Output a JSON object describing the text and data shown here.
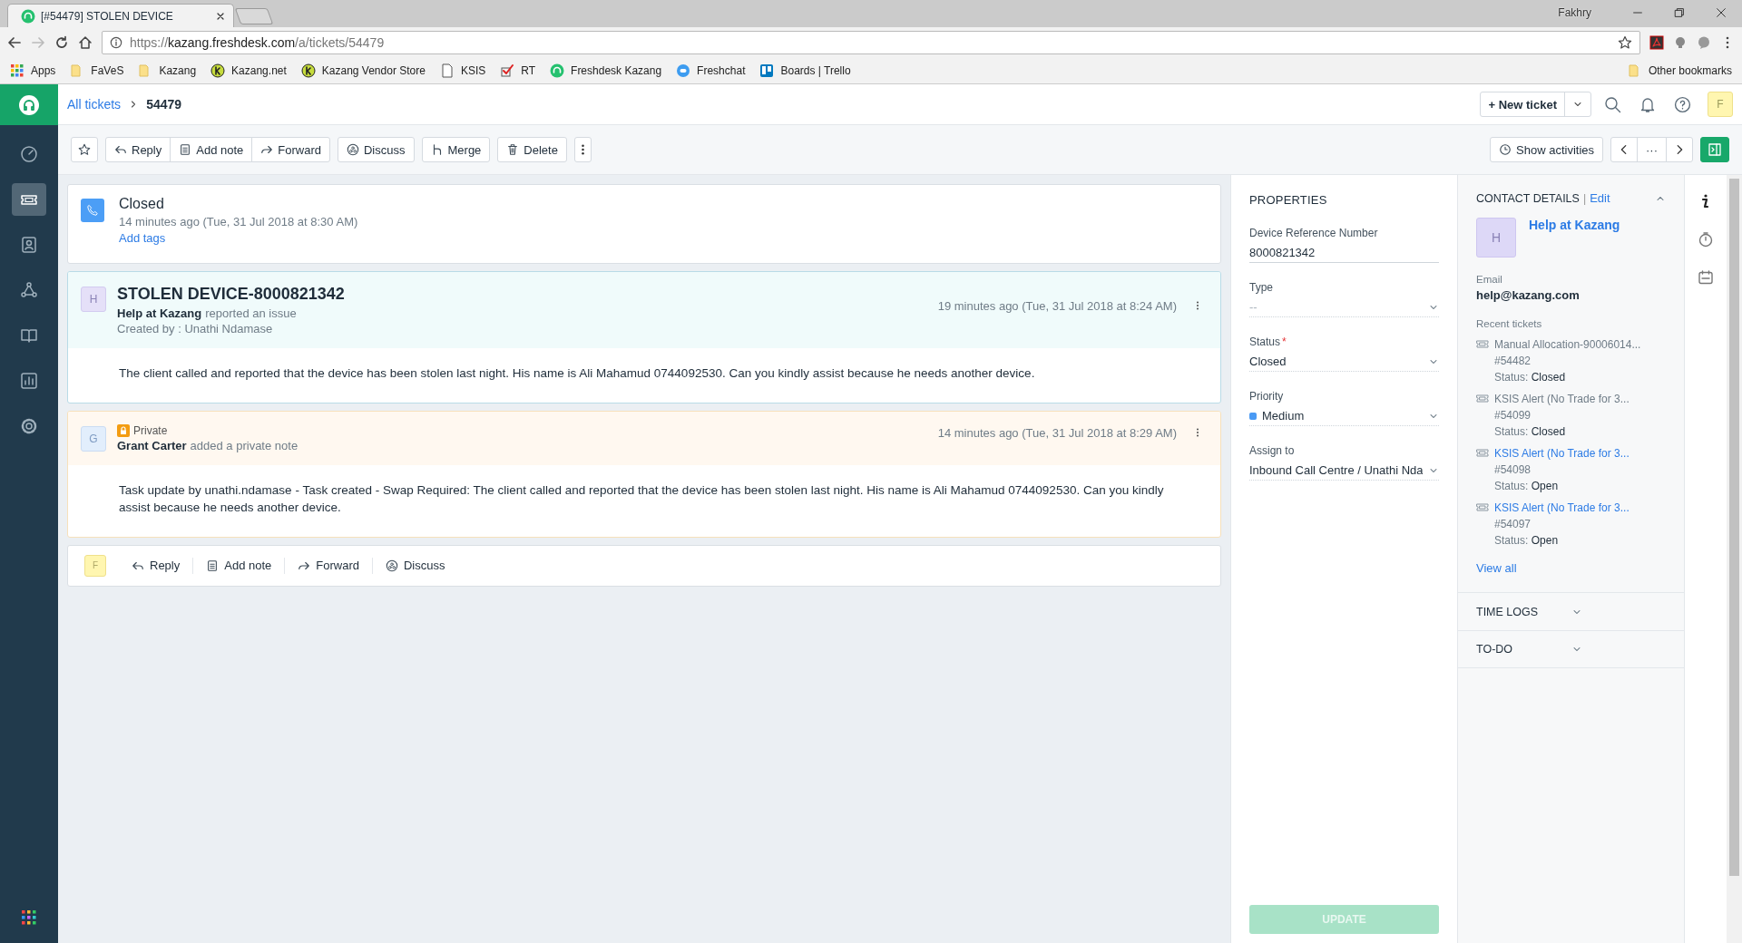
{
  "browser": {
    "tab_title": "[#54479] STOLEN DEVICE",
    "profile": "Fakhry",
    "url_scheme": "https://",
    "url_host": "kazang.freshdesk.com",
    "url_path": "/a/tickets/54479",
    "bookmarks": [
      {
        "label": "Apps",
        "kind": "apps"
      },
      {
        "label": "FaVeS",
        "kind": "folder"
      },
      {
        "label": "Kazang",
        "kind": "folder"
      },
      {
        "label": "Kazang.net",
        "kind": "k"
      },
      {
        "label": "Kazang Vendor Store",
        "kind": "k"
      },
      {
        "label": "KSIS",
        "kind": "page"
      },
      {
        "label": "RT",
        "kind": "check"
      },
      {
        "label": "Freshdesk Kazang",
        "kind": "headset"
      },
      {
        "label": "Freshchat",
        "kind": "chat"
      },
      {
        "label": "Boards | Trello",
        "kind": "board"
      }
    ],
    "other_bookmarks": "Other bookmarks"
  },
  "sidebar": {
    "items": [
      {
        "kind": "dashboard",
        "selected": false
      },
      {
        "kind": "tickets",
        "selected": true
      },
      {
        "kind": "contacts",
        "selected": false
      },
      {
        "kind": "social",
        "selected": false
      },
      {
        "kind": "solutions",
        "selected": false
      },
      {
        "kind": "reports",
        "selected": false
      },
      {
        "kind": "admin",
        "selected": false
      }
    ]
  },
  "header": {
    "breadcrumb": "All tickets",
    "ticket_id": "54479",
    "new_ticket": "New ticket",
    "new_ticket_plus": "+",
    "avatar": "F"
  },
  "toolbar": {
    "actions": [
      {
        "label": "Reply",
        "kind": "reply",
        "grouped": true
      },
      {
        "label": "Add note",
        "kind": "note",
        "grouped": true
      },
      {
        "label": "Forward",
        "kind": "forward",
        "grouped": true
      },
      {
        "label": "Discuss",
        "kind": "discuss",
        "grouped": false
      },
      {
        "label": "Merge",
        "kind": "merge",
        "grouped": false
      },
      {
        "label": "Delete",
        "kind": "delete",
        "grouped": false
      }
    ],
    "show_activities": "Show activities",
    "pager_middle": "···"
  },
  "status_card": {
    "status": "Closed",
    "time": "14 minutes ago (Tue, 31 Jul 2018 at 8:30 AM)",
    "add_tags": "Add tags"
  },
  "conversations": [
    {
      "kind": "issue",
      "avatar": "H",
      "title": "STOLEN DEVICE-8000821342",
      "author": "Help at Kazang",
      "action": "reported an issue",
      "created_by": "Created by : Unathi Ndamase",
      "time": "19 minutes ago (Tue, 31 Jul 2018 at 8:24 AM)",
      "body": "The client called and reported that the device has been stolen last night. His name is Ali Mahamud 0744092530. Can you kindly assist because he needs another device."
    },
    {
      "kind": "note",
      "avatar": "G",
      "badge": "Private",
      "author": "Grant Carter",
      "action": "added a private note",
      "time": "14 minutes ago (Tue, 31 Jul 2018 at 8:29 AM)",
      "body": "Task update by unathi.ndamase - Task created - Swap Required: The client called and reported that the device has been stolen last night. His name is Ali Mahamud 0744092530. Can you kindly assist because he needs another device."
    }
  ],
  "reply_bar": {
    "avatar": "F",
    "actions": [
      {
        "label": "Reply",
        "kind": "reply"
      },
      {
        "label": "Add note",
        "kind": "note"
      },
      {
        "label": "Forward",
        "kind": "forward"
      },
      {
        "label": "Discuss",
        "kind": "discuss"
      }
    ]
  },
  "properties": {
    "title": "PROPERTIES",
    "fields": [
      {
        "label": "Device Reference Number",
        "kind": "text",
        "required": false,
        "value": "8000821342"
      },
      {
        "label": "Type",
        "kind": "select",
        "required": false,
        "placeholder": "--"
      },
      {
        "label": "Status",
        "kind": "select",
        "required": true,
        "value": "Closed"
      },
      {
        "label": "Priority",
        "kind": "select",
        "required": false,
        "value": "Medium",
        "color": "#4a9af4"
      },
      {
        "label": "Assign to",
        "kind": "select",
        "required": false,
        "value": "Inbound Call Centre / Unathi Nda"
      }
    ],
    "required_mark": "*",
    "update": {
      "label": "UPDATE",
      "disabled": true
    }
  },
  "contact": {
    "title": "CONTACT DETAILS",
    "separator": "|",
    "edit": "Edit",
    "expanded": true,
    "avatar": "H",
    "name": "Help at Kazang",
    "email_label": "Email",
    "email": "help@kazang.com",
    "recent_label": "Recent tickets",
    "recent": [
      {
        "title": "Manual Allocation-90006014...",
        "number": "#54482",
        "status_label": "Status:",
        "status": "Closed",
        "highlighted": false
      },
      {
        "title": "KSIS Alert (No Trade for 3...",
        "number": "#54099",
        "status_label": "Status:",
        "status": "Closed",
        "highlighted": false
      },
      {
        "title": "KSIS Alert (No Trade for 3...",
        "number": "#54098",
        "status_label": "Status:",
        "status": "Open",
        "highlighted": true
      },
      {
        "title": "KSIS Alert (No Trade for 3...",
        "number": "#54097",
        "status_label": "Status:",
        "status": "Open",
        "highlighted": true
      }
    ],
    "view_all": "View all"
  },
  "sections": [
    {
      "title": "TIME LOGS",
      "expanded": false
    },
    {
      "title": "TO-DO",
      "expanded": false
    }
  ],
  "rail": [
    {
      "kind": "info"
    },
    {
      "kind": "timer"
    },
    {
      "kind": "calendar"
    }
  ]
}
